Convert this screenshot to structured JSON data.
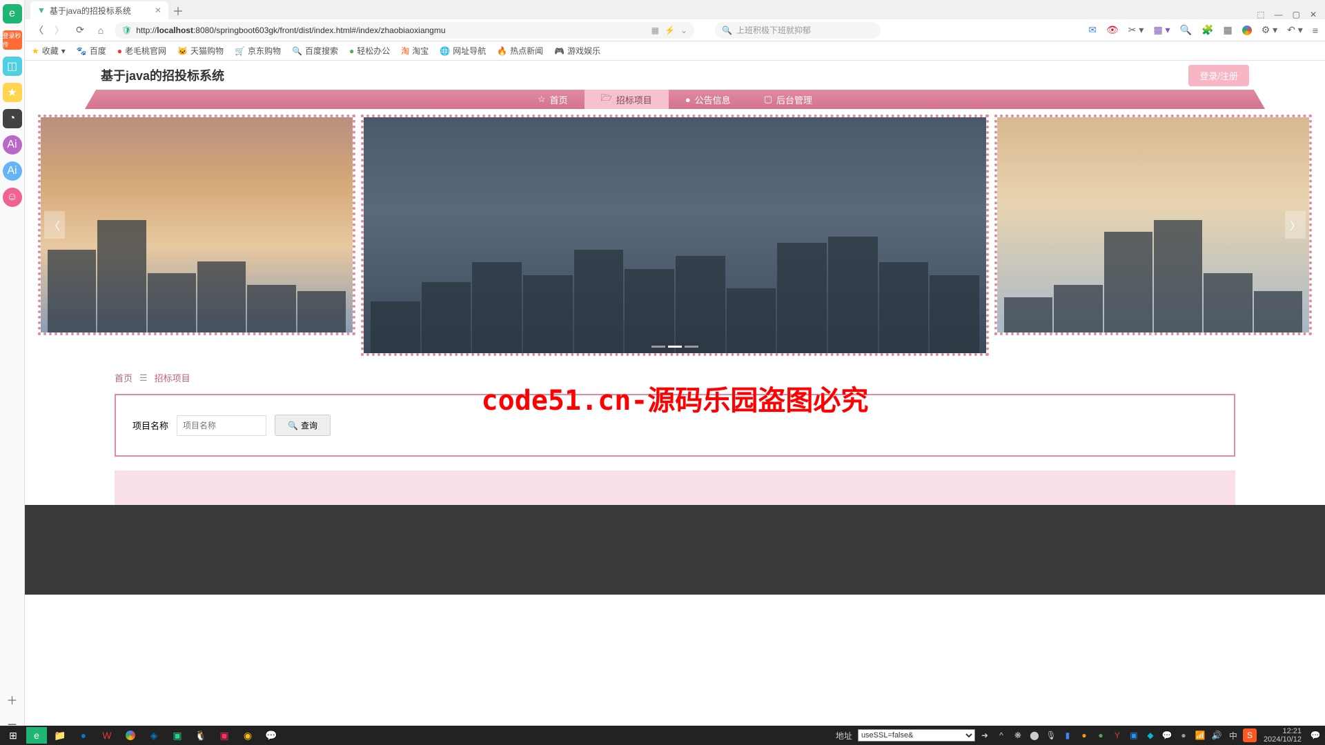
{
  "browser": {
    "tab_title": "基于java的招投标系统",
    "url_prefix": "http://",
    "url_host": "localhost",
    "url_port_path": ":8080/springboot603gk/front/dist/index.html#/index/zhaobiaoxiangmu",
    "search_placeholder": "上班积极下班就抑郁"
  },
  "bookmarks": {
    "fav": "收藏",
    "baidu": "百度",
    "laomaotao": "老毛桃官网",
    "tmall": "天猫购物",
    "jd": "京东购物",
    "baidusearch": "百度搜索",
    "qingsong": "轻松办公",
    "taobao": "淘宝",
    "nav": "网址导航",
    "news": "热点新闻",
    "game": "游戏娱乐"
  },
  "page": {
    "title": "基于java的招投标系统",
    "login_label": "登录/注册",
    "nav": {
      "home": "首页",
      "bid": "招标项目",
      "notice": "公告信息",
      "admin": "后台管理"
    },
    "breadcrumb": {
      "home": "首页",
      "current": "招标项目"
    },
    "search": {
      "label": "项目名称",
      "placeholder": "项目名称",
      "button": "查询"
    },
    "watermark": "code51.cn-源码乐园盗图必究"
  },
  "taskbar": {
    "addr_label": "地址",
    "addr_value": "useSSL=false&",
    "time": "12:21",
    "date": "2024/10/12"
  },
  "sidebar": {
    "badge": "登录秒传"
  }
}
